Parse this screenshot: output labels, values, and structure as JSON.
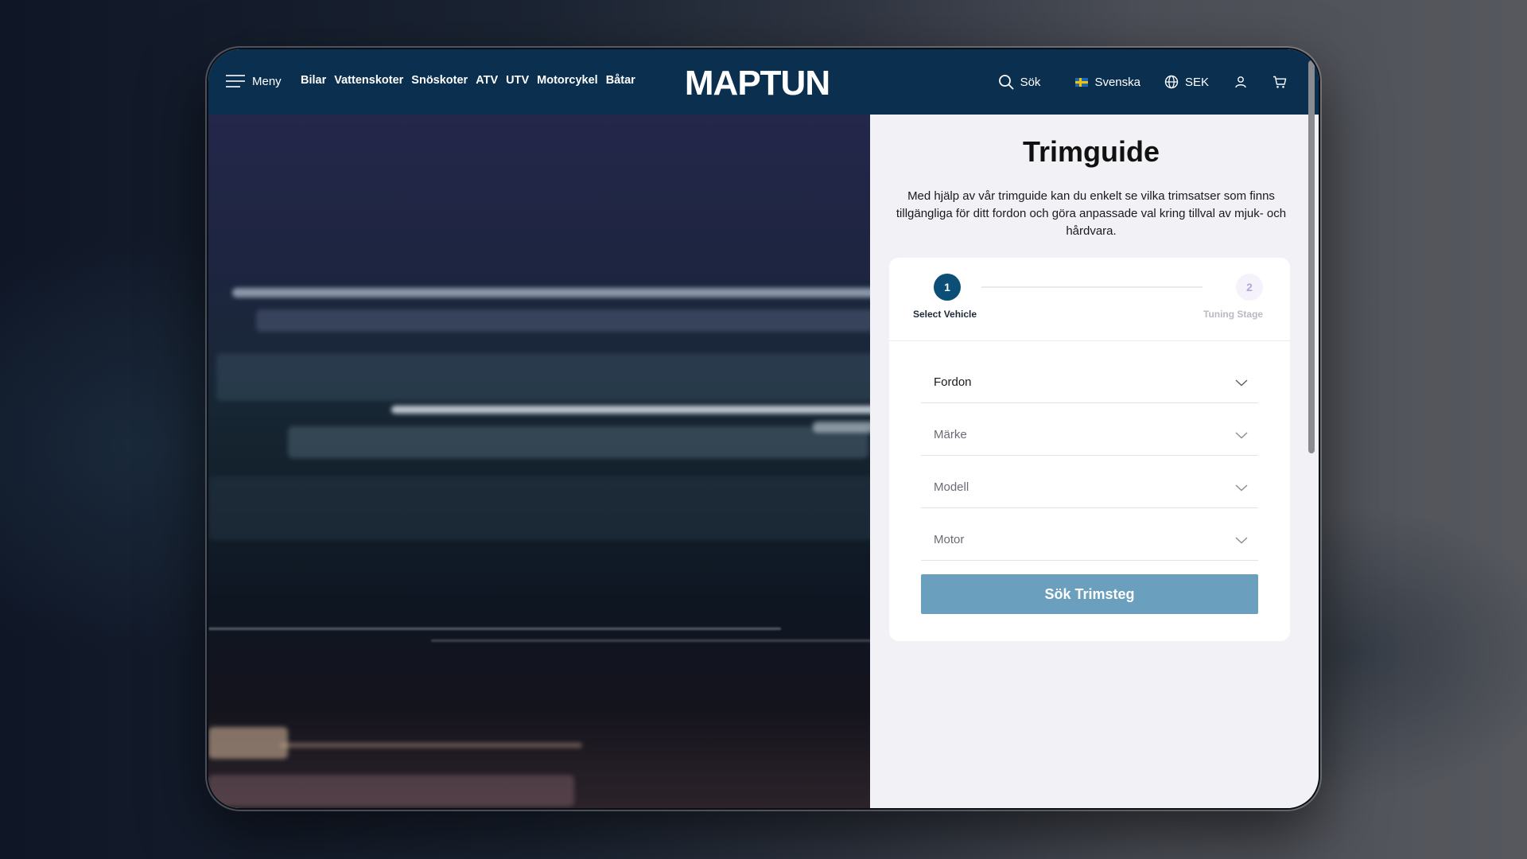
{
  "header": {
    "menu_label": "Meny",
    "nav_items": [
      "Bilar",
      "Vattenskoter",
      "Snöskoter",
      "ATV",
      "UTV",
      "Motorcykel",
      "Båtar"
    ],
    "logo_text": "MAPTUN",
    "search_label": "Sök",
    "language_label": "Svenska",
    "currency_label": "SEK"
  },
  "panel": {
    "title": "Trimguide",
    "description": "Med hjälp av vår trimguide kan du enkelt se vilka trimsatser som finns tillgängliga för ditt fordon och göra anpassade val kring tillval av mjuk- och hårdvara."
  },
  "stepper": {
    "steps": [
      {
        "number": "1",
        "label": "Select Vehicle",
        "active": true
      },
      {
        "number": "2",
        "label": "Tuning Stage",
        "active": false
      }
    ]
  },
  "form": {
    "fields": [
      {
        "label": "Fordon"
      },
      {
        "label": "Märke"
      },
      {
        "label": "Modell"
      },
      {
        "label": "Motor"
      }
    ],
    "submit_label": "Sök Trimsteg"
  },
  "colors": {
    "header_bg": "#0b2f4e",
    "step_active": "#0b4f76",
    "button_bg": "#6a9fbd",
    "panel_bg": "#f2f1f6"
  },
  "icons": [
    "hamburger-icon",
    "search-icon",
    "flag-icon",
    "globe-icon",
    "user-icon",
    "cart-icon",
    "chevron-down-icon"
  ]
}
